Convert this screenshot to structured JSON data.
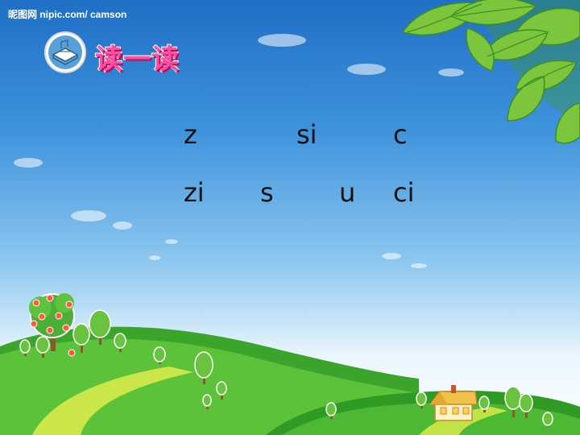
{
  "watermark": "昵图网 nipic.com/ camson",
  "heading": "读一读",
  "row1": [
    "z",
    "si",
    "c"
  ],
  "row2": [
    "zi",
    "s",
    "u",
    "ci"
  ],
  "icons": {
    "badge": "book-icon",
    "leaves": "leaf-icon",
    "tree": "apple-tree-icon",
    "house": "house-icon"
  }
}
